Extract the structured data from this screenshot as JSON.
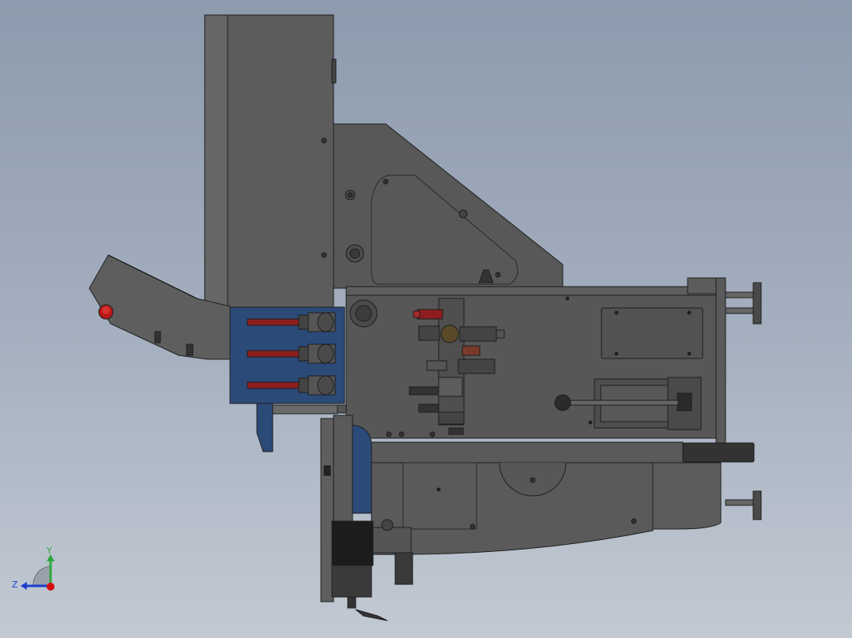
{
  "viewport": {
    "background_top": "#8d9bae",
    "background_bottom": "#c2c9d3"
  },
  "triad": {
    "y_label": "Y",
    "z_label": "Z",
    "y_color": "#2fa83a",
    "z_color": "#1a3fcf",
    "origin_color": "#d01010"
  },
  "model": {
    "body_color": "#5a5a5a",
    "edge_color": "#1e1e1e",
    "accent_blue": "#2c4a78",
    "drill_red": "#8e1e1e"
  }
}
